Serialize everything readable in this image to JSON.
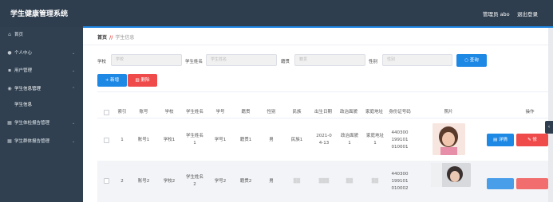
{
  "header": {
    "title": "学生健康管理系统",
    "admin": "管理员 abo",
    "logout": "退出登录"
  },
  "sidebar": {
    "items": [
      {
        "label": "首页",
        "icon": "home-icon",
        "chevron": ""
      },
      {
        "label": "个人中心",
        "icon": "user-icon",
        "chevron": "⌄"
      },
      {
        "label": "用户管理",
        "icon": "users-icon",
        "chevron": "⌄"
      },
      {
        "label": "学生信息管理",
        "icon": "location-icon",
        "chevron": "⌃"
      },
      {
        "label": "学生信息",
        "icon": "",
        "chevron": ""
      },
      {
        "label": "学生体检报告管理",
        "icon": "grid-icon",
        "chevron": "⌄"
      },
      {
        "label": "学生群体报告管理",
        "icon": "grid-icon",
        "chevron": "⌄"
      }
    ]
  },
  "breadcrumb": {
    "home": "首页",
    "sep": "//",
    "current": "学生信息"
  },
  "search": {
    "school_label": "学校",
    "school_placeholder": "学校",
    "name_label": "学生姓名",
    "name_placeholder": "学生姓名",
    "origin_label": "籍贯",
    "origin_placeholder": "籍贯",
    "gender_label": "性别",
    "gender_placeholder": "性别",
    "query_label": "查询"
  },
  "actions": {
    "add_label": "新增",
    "delete_label": "删除"
  },
  "table": {
    "headers": [
      "索引",
      "账号",
      "学校",
      "学生姓名",
      "学号",
      "籍贯",
      "性别",
      "民族",
      "出生日期",
      "政治面貌",
      "家庭地址",
      "身份证号码",
      "照片",
      "操作"
    ],
    "rows": [
      {
        "index": "1",
        "account": "账号1",
        "school": "学校1",
        "name": "学生姓名1",
        "student_no": "学号1",
        "origin": "籍贯1",
        "gender": "男",
        "ethnic": "民族1",
        "birth": "2021-04-13",
        "politics": "政治面貌1",
        "address": "家庭地址1",
        "id_no": "440300199101010001",
        "detail_label": "详情",
        "edit_label": "修"
      },
      {
        "index": "2",
        "account": "账号2",
        "school": "学校2",
        "name": "学生姓名2",
        "student_no": "学号2",
        "origin": "籍贯2",
        "gender": "男",
        "ethnic": "",
        "birth": "",
        "politics": "",
        "address": "",
        "id_no": "440300199101010002",
        "detail_label": "",
        "edit_label": ""
      }
    ]
  },
  "colors": {
    "topbar": "#2f3e4e",
    "sidebar": "#304050",
    "primary": "#1e88e5",
    "danger": "#f04b4b"
  }
}
